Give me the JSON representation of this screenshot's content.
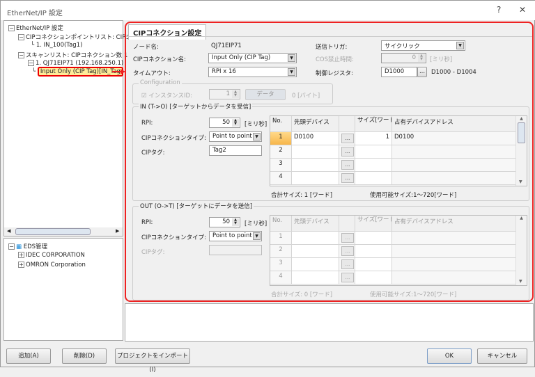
{
  "window": {
    "title": "EtherNet/IP 設定",
    "help": "?",
    "close": "✕"
  },
  "tree": {
    "root": "EtherNet/IP 設定",
    "point_list": "CIPコネクションポイントリスト: CIPコネ",
    "point_item": "1. IN_100(Tag1)",
    "scan_list": "スキャンリスト: CIPコネクション数 1",
    "scan_node": "1. QJ71EIP71 (192.168.250.1)",
    "scan_conn": "Input Only (CIP Tag)[IN_Tag"
  },
  "eds": {
    "root": "EDS管理",
    "items": [
      "IDEC CORPORATION",
      "OMRON Corporation"
    ]
  },
  "tab": "CIPコネクション設定",
  "form": {
    "node_label": "ノード名:",
    "node_value": "QJ71EIP71",
    "conn_label": "CIPコネクション名:",
    "conn_value": "Input Only (CIP Tag)",
    "timeout_label": "タイムアウト:",
    "timeout_value": "RPI x 16",
    "trigger_label": "送信トリガ:",
    "trigger_value": "サイクリック",
    "cos_label": "COS禁止時間:",
    "cos_value": "0",
    "cos_unit": "[ミリ秒]",
    "reg_label": "制御レジスタ:",
    "reg_value": "D1000",
    "reg_range": "D1000 - D1004"
  },
  "config": {
    "title": "Configuration",
    "instance_label": "インスタンスID:",
    "instance_checked": true,
    "instance_value": "1",
    "data_button": "データ",
    "size": "0 [バイト]"
  },
  "in": {
    "title": "IN (T->O) [ターゲットからデータを受信]",
    "rpi_label": "RPI:",
    "rpi_value": "50",
    "rpi_unit": "[ミリ秒]",
    "type_label": "CIPコネクションタイプ:",
    "type_value": "Point to point",
    "tag_label": "CIPタグ:",
    "tag_value": "Tag2",
    "columns": [
      "No.",
      "先頭デバイス",
      "",
      "サイズ[ワード]",
      "占有デバイスアドレス"
    ],
    "rows": [
      {
        "no": "1",
        "device": "D0100",
        "size": "1",
        "address": "D0100"
      },
      {
        "no": "2",
        "device": "",
        "size": "",
        "address": ""
      },
      {
        "no": "3",
        "device": "",
        "size": "",
        "address": ""
      },
      {
        "no": "4",
        "device": "",
        "size": "",
        "address": ""
      }
    ],
    "total": "合計サイズ: 1 [ワード]",
    "available": "使用可能サイズ:1～720[ワード]"
  },
  "out": {
    "title": "OUT (O->T) [ターゲットにデータを送信]",
    "rpi_label": "RPI:",
    "rpi_value": "50",
    "rpi_unit": "[ミリ秒]",
    "type_label": "CIPコネクションタイプ:",
    "type_value": "Point to point",
    "tag_label": "CIPタグ:",
    "tag_value": "",
    "columns": [
      "No.",
      "先頭デバイス",
      "",
      "サイズ[ワード]",
      "占有デバイスアドレス"
    ],
    "rows": [
      {
        "no": "1",
        "device": "",
        "size": "",
        "address": ""
      },
      {
        "no": "2",
        "device": "",
        "size": "",
        "address": ""
      },
      {
        "no": "3",
        "device": "",
        "size": "",
        "address": ""
      },
      {
        "no": "4",
        "device": "",
        "size": "",
        "address": ""
      }
    ],
    "total": "合計サイズ: 0 [ワード]",
    "available": "使用可能サイズ:1～720[ワード]"
  },
  "buttons": {
    "add": "追加(A)",
    "delete": "削除(D)",
    "import": "プロジェクトをインポート(I)",
    "ok": "OK",
    "cancel": "キャンセル",
    "ellipsis": "..."
  },
  "colors": {
    "highlight": "#e02020",
    "selected_row": "#f7b64a"
  }
}
